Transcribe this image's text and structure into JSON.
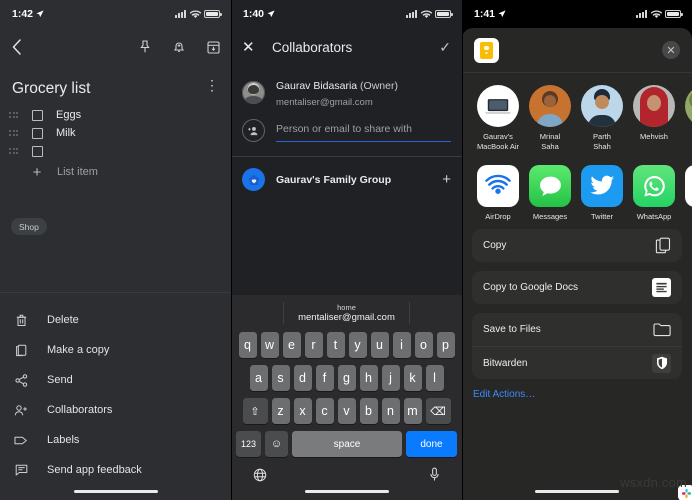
{
  "panel1": {
    "status": {
      "time": "1:42"
    },
    "toolbar": {
      "back": "‹",
      "pin": "pin-icon",
      "reminder": "bell-icon",
      "archive": "archive-icon"
    },
    "note_title": "Grocery list",
    "overflow": "⋮",
    "items": [
      {
        "text": "Eggs",
        "checked": false
      },
      {
        "text": "Milk",
        "checked": false
      },
      {
        "text": "",
        "checked": false
      }
    ],
    "add_item_label": "List item",
    "label_chip": "Shop",
    "menu": [
      {
        "label": "Delete",
        "icon": "trash-icon"
      },
      {
        "label": "Make a copy",
        "icon": "copy-icon"
      },
      {
        "label": "Send",
        "icon": "share-icon"
      },
      {
        "label": "Collaborators",
        "icon": "person-add-icon"
      },
      {
        "label": "Labels",
        "icon": "label-icon"
      },
      {
        "label": "Send app feedback",
        "icon": "feedback-icon"
      }
    ]
  },
  "panel2": {
    "status": {
      "time": "1:40"
    },
    "header": {
      "close": "✕",
      "title": "Collaborators",
      "confirm": "✓"
    },
    "owner": {
      "name": "Gaurav Bidasaria",
      "role": "(Owner)",
      "email": "mentaliser@gmail.com"
    },
    "share_input": {
      "value": "",
      "placeholder": "Person or email to share with"
    },
    "group": {
      "name": "Gaurav's Family Group",
      "add": "+"
    },
    "keyboard": {
      "suggestion_top": "home",
      "suggestion_main": "mentaliser@gmail.com",
      "row1": [
        "q",
        "w",
        "e",
        "r",
        "t",
        "y",
        "u",
        "i",
        "o",
        "p"
      ],
      "row2": [
        "a",
        "s",
        "d",
        "f",
        "g",
        "h",
        "j",
        "k",
        "l"
      ],
      "row3": [
        "z",
        "x",
        "c",
        "v",
        "b",
        "n",
        "m"
      ],
      "shift": "⇧",
      "backspace": "⌫",
      "numbers": "123",
      "emoji": "☺",
      "space": "space",
      "done": "done",
      "globe": "globe-icon",
      "mic": "mic-icon"
    }
  },
  "panel3": {
    "status": {
      "time": "1:41"
    },
    "doc_icon": "google-keep-icon",
    "close": "✕",
    "people": [
      {
        "name": "Gaurav's\nMacBook Air",
        "line1": "Gaurav's",
        "line2": "MacBook Air",
        "badge": "airdrop-icon",
        "color": "#ffffff"
      },
      {
        "name": "Mrinal Saha",
        "line1": "Mrinal",
        "line2": "Saha",
        "badge": "slack-icon",
        "color": "#c7732f"
      },
      {
        "name": "Parth Shah",
        "line1": "Parth",
        "line2": "Shah",
        "badge": "messages-icon",
        "color": "#bcd6ea"
      },
      {
        "name": "Mehvish",
        "line1": "Mehvish",
        "line2": "",
        "badge": "slack-icon",
        "color": "#b8b8b8"
      },
      {
        "name": "",
        "line1": "",
        "line2": "",
        "badge": "",
        "color": "#93a76a"
      }
    ],
    "apps": [
      {
        "label": "AirDrop",
        "icon": "airdrop-icon"
      },
      {
        "label": "Messages",
        "icon": "messages-icon"
      },
      {
        "label": "Twitter",
        "icon": "twitter-icon"
      },
      {
        "label": "WhatsApp",
        "icon": "whatsapp-icon"
      },
      {
        "label": "",
        "icon": "slack-icon"
      }
    ],
    "actions_group1": [
      {
        "label": "Copy",
        "icon": "copy-icon"
      }
    ],
    "actions_group2": [
      {
        "label": "Copy to Google Docs",
        "icon": "google-docs-icon"
      }
    ],
    "actions_group3": [
      {
        "label": "Save to Files",
        "icon": "folder-icon"
      },
      {
        "label": "Bitwarden",
        "icon": "shield-icon"
      }
    ],
    "edit_actions": "Edit Actions…"
  },
  "watermark": "wsxdn.com",
  "colors": {
    "accent_blue": "#1a73e8",
    "keyboard_done": "#0a7bff",
    "keep_yellow": "#fbbc04",
    "link_blue": "#3d8bff"
  }
}
